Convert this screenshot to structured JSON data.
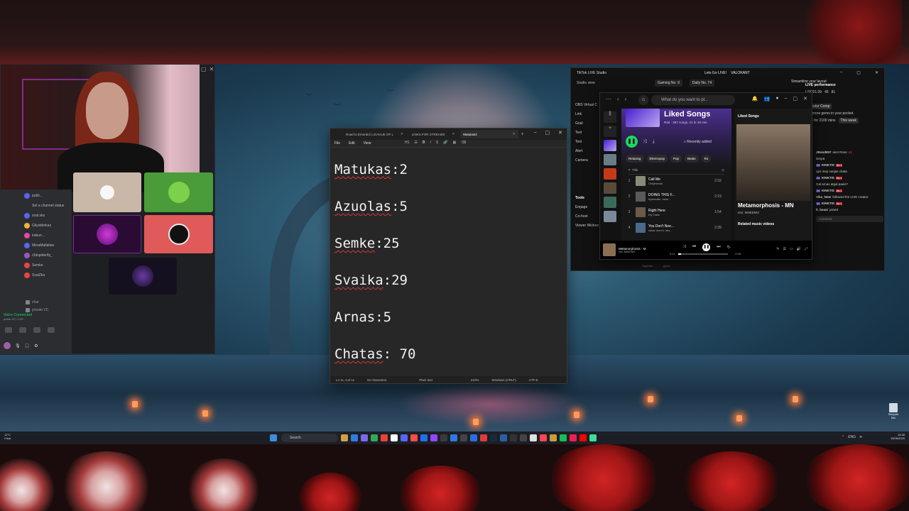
{
  "notepad": {
    "tabs": [
      {
        "label": "Road to Emerald | LEAGUE OF L",
        "active": false
      },
      {
        "label": "LINKS FOR STREAMS",
        "active": false
      },
      {
        "label": "Matukas2",
        "active": true
      }
    ],
    "menu": [
      "File",
      "Edit",
      "View"
    ],
    "heading_level": "H1",
    "lines": [
      {
        "name": "Matukas",
        "value": "2"
      },
      {
        "name": "Azuolas",
        "value": "5"
      },
      {
        "name": "Semke",
        "value": "25"
      },
      {
        "name": "Svaika",
        "value": "29"
      },
      {
        "name": "Arnas",
        "value": "5"
      },
      {
        "name": "Chatas",
        "value": " 70"
      }
    ],
    "status": {
      "position": "Ln 11, Col 11",
      "chars": "62 characters",
      "format": "Plain text",
      "zoom": "410%",
      "line_ending": "Windows (CRLF)",
      "encoding": "UTF-8"
    }
  },
  "discord": {
    "members": [
      {
        "name": "publi...",
        "color": "#23a55a"
      },
      {
        "name": "zoal.sks",
        "color": "#5865f2"
      },
      {
        "name": "Gilyoblinkas",
        "color": "#f0b232"
      },
      {
        "name": "irakun...",
        "color": "#eb459e"
      },
      {
        "name": "MeraMallaltas",
        "color": "#5865f2"
      },
      {
        "name": "r3dspider8y_",
        "color": "#9b59b6"
      },
      {
        "name": "Semke",
        "color": "#ed4245"
      },
      {
        "name": "SvaiZka",
        "color": "#ed4245"
      }
    ],
    "status_line": "Set a channel status",
    "channels": [
      "chat",
      "private VC"
    ],
    "voice": {
      "title": "Voice Connected",
      "sub": "public VC / CAT..."
    }
  },
  "tiktok": {
    "title": "TikTok LIVE Studio",
    "center_title": "Lets Go LIVE!",
    "game": "VALORANT",
    "view_label": "Studio view",
    "chips": [
      "Gaming No. 9",
      "Daily No. 74"
    ],
    "streamline": "Streamline your layout",
    "performance_title": "LIVE performance",
    "stats": [
      "USD21.09",
      "45",
      "81",
      "28"
    ],
    "creator_comp": "Creator Comp",
    "promo": "220 more gems in your pocket.",
    "live_for": "LIVE for 2100 mins",
    "this_week": "This week",
    "chat_title": "chat",
    "sources": [
      "OBS Virtual C",
      "Link",
      "Goal",
      "Text",
      "Text",
      "Alert",
      "Camera"
    ],
    "tools_title": "Tools",
    "tools": [
      "Engage",
      "Co-host",
      "Viewer Wishes"
    ],
    "bottom_tabs": [
      "Together",
      "game"
    ],
    "chat": [
      {
        "user": "JBond007",
        "text": "sent Rose",
        "gift": "x1"
      },
      {
        "user": "",
        "text": "lampa"
      },
      {
        "user": "KINKTIS",
        "text": "ops mvp nuejas chata"
      },
      {
        "user": "KINKTIS",
        "text": "Gal arnas atgal paeis?"
      },
      {
        "user": "KINKTIS",
        "text": ""
      },
      {
        "user": "Vika_Now",
        "text": "followed the LIVE creator"
      },
      {
        "user": "KINKTIS",
        "text": ""
      },
      {
        "user": "lt_beast",
        "text": "joined"
      }
    ],
    "chat_placeholder": "comment"
  },
  "spotify": {
    "search_placeholder": "What do you want to pl...",
    "playlist_title": "Liked Songs",
    "playlist_meta": "R3d · 387 songs, 21 hr 26 min",
    "sort": "Recently added",
    "chips": [
      "Relaxing",
      "Electropop",
      "Pop",
      "Beats",
      "Ro"
    ],
    "column_title": "Title",
    "tracks": [
      {
        "num": "1",
        "title": "Call Me",
        "artist": "Onlyfriends",
        "duration": "2:32"
      },
      {
        "num": "2",
        "title": "DOING THIS F...",
        "artist": "bystander, emer...",
        "duration": "2:19"
      },
      {
        "num": "3",
        "title": "Right Here",
        "artist": "Ely Oaks",
        "duration": "1:54"
      },
      {
        "num": "4",
        "title": "You Don't Nee...",
        "artist": "oskar med k, kris...",
        "duration": "2:39"
      }
    ],
    "panel_header": "Liked Songs",
    "panel_song": "Metamorphosis - MN",
    "panel_artist": "emi, MNEEMO",
    "panel_related": "Related music videos",
    "now_playing": {
      "title": "Metamorphosis - M",
      "artist": "emi, MNEEMO"
    },
    "elapsed": "0:11",
    "total": "2:08",
    "progress": 0.06
  },
  "taskbar": {
    "weather_temp": "12°C",
    "weather_desc": "Clear",
    "search_label": "Search",
    "time": "16:48",
    "date": "15/06/2025",
    "lang": "ENG"
  },
  "desktop": {
    "recycle_bin": "Recycle Bin"
  }
}
